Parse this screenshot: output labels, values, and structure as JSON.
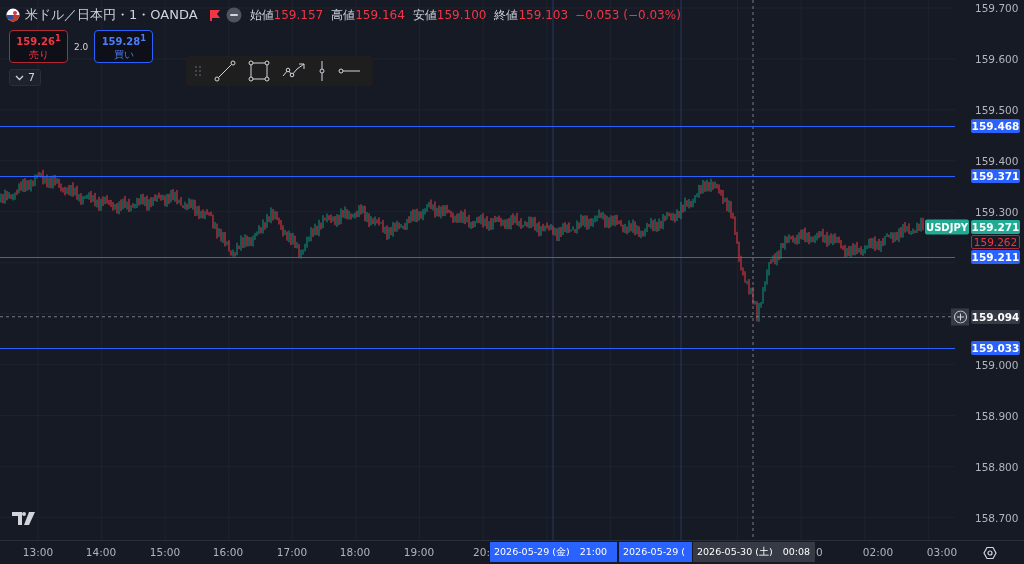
{
  "header": {
    "symbol": "米ドル／日本円・1・OANDA",
    "ohlc": [
      {
        "label": "始値",
        "value": "159.157"
      },
      {
        "label": "高値",
        "value": "159.164"
      },
      {
        "label": "安値",
        "value": "159.100"
      },
      {
        "label": "終値",
        "value": "159.103"
      }
    ],
    "change": "−0.053 (−0.03%)"
  },
  "trade": {
    "sell": {
      "price": "159.26$^{1}$",
      "label": "売り"
    },
    "spread": "2.0",
    "buy": {
      "price": "159.28$^{1}$",
      "label": "買い"
    }
  },
  "indicators_toggle": {
    "count": "7"
  },
  "drawing_toolbar": {
    "tools": [
      {
        "kind": "trend-line"
      },
      {
        "kind": "rectangle"
      },
      {
        "kind": "path"
      },
      {
        "kind": "vertical-line"
      },
      {
        "kind": "horizontal-ray"
      }
    ]
  },
  "price_axis": {
    "ticks": [
      "159.700",
      "159.600",
      "159.500",
      "159.400",
      "159.300",
      "159.000",
      "158.900",
      "158.800",
      "158.700"
    ]
  },
  "price_lines": [
    {
      "price": "159.468"
    },
    {
      "price": "159.371"
    },
    {
      "price": "159.211"
    },
    {
      "price": "159.033"
    }
  ],
  "symbol_label": "USDJPY",
  "last_price": "159.271",
  "bid_price": "159.262",
  "crosshair_price": "159.094",
  "time_axis": {
    "ticks": [
      "13:00",
      "14:00",
      "15:00",
      "16:00",
      "17:00",
      "18:00",
      "19:00",
      "20:",
      "0",
      "02:00",
      "03:00"
    ]
  },
  "time_labels": [
    {
      "kind": "marker",
      "text": "2026-05-29 (金)　21:00"
    },
    {
      "kind": "marker",
      "text": "2026-05-29 ("
    },
    {
      "kind": "crosshair",
      "text": "2026-05-30 (土)　00:08"
    }
  ]
}
